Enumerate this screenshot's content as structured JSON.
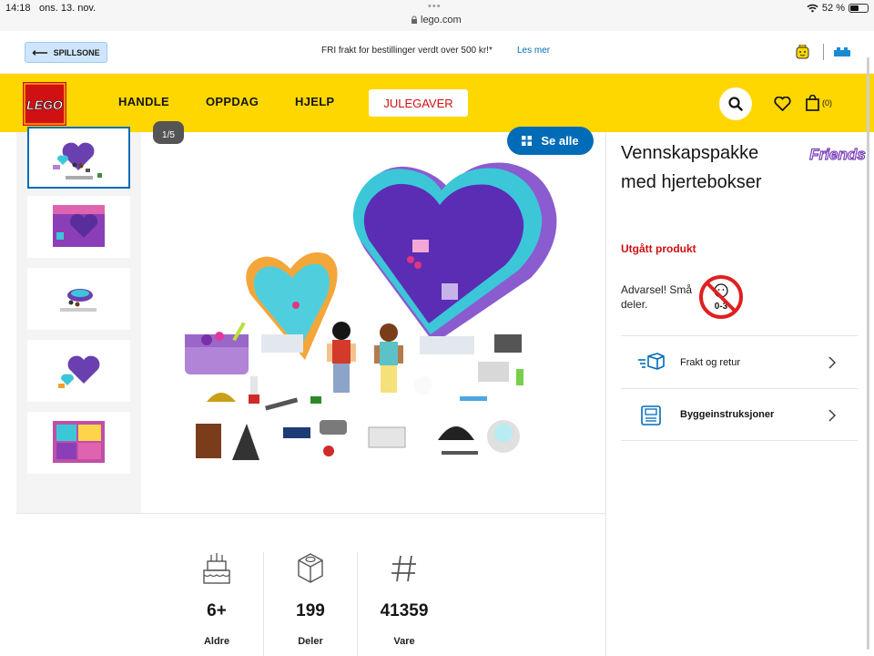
{
  "status_bar": {
    "time": "14:18",
    "date": "ons. 13. nov.",
    "url": "lego.com",
    "battery": "52 %",
    "battery_level": 0.52
  },
  "banner": {
    "playzone_label": "SPILLSONE",
    "promo_text": "FRI frakt for bestillinger verdt over 500 kr!*",
    "promo_link": "Les mer"
  },
  "nav": {
    "logo_text": "LEGO",
    "items": [
      "HANDLE",
      "OPPDAG",
      "HJELP"
    ],
    "highlight": "JULEGAVER",
    "cart_count": "(0)"
  },
  "gallery": {
    "counter": "1/5",
    "see_all": "Se alle",
    "thumb_count": 5
  },
  "product": {
    "title": "Vennskapspakke med hjertebokser",
    "brand_logo_text": "Friends",
    "status": "Utgått produkt",
    "warning": "Advarsel! Små deler.",
    "age_badge": "0-3",
    "rows": [
      {
        "label": "Frakt og retur",
        "icon": "shipping-icon"
      },
      {
        "label": "Byggeinstruksjoner",
        "icon": "instructions-icon"
      }
    ]
  },
  "specs": [
    {
      "value": "6+",
      "label": "Aldre",
      "icon": "cake-icon"
    },
    {
      "value": "199",
      "label": "Deler",
      "icon": "brick-icon"
    },
    {
      "value": "41359",
      "label": "Vare",
      "icon": "hash-icon"
    }
  ],
  "colors": {
    "lego_yellow": "#ffd700",
    "lego_red": "#d01012",
    "accent_blue": "#006cb7"
  }
}
